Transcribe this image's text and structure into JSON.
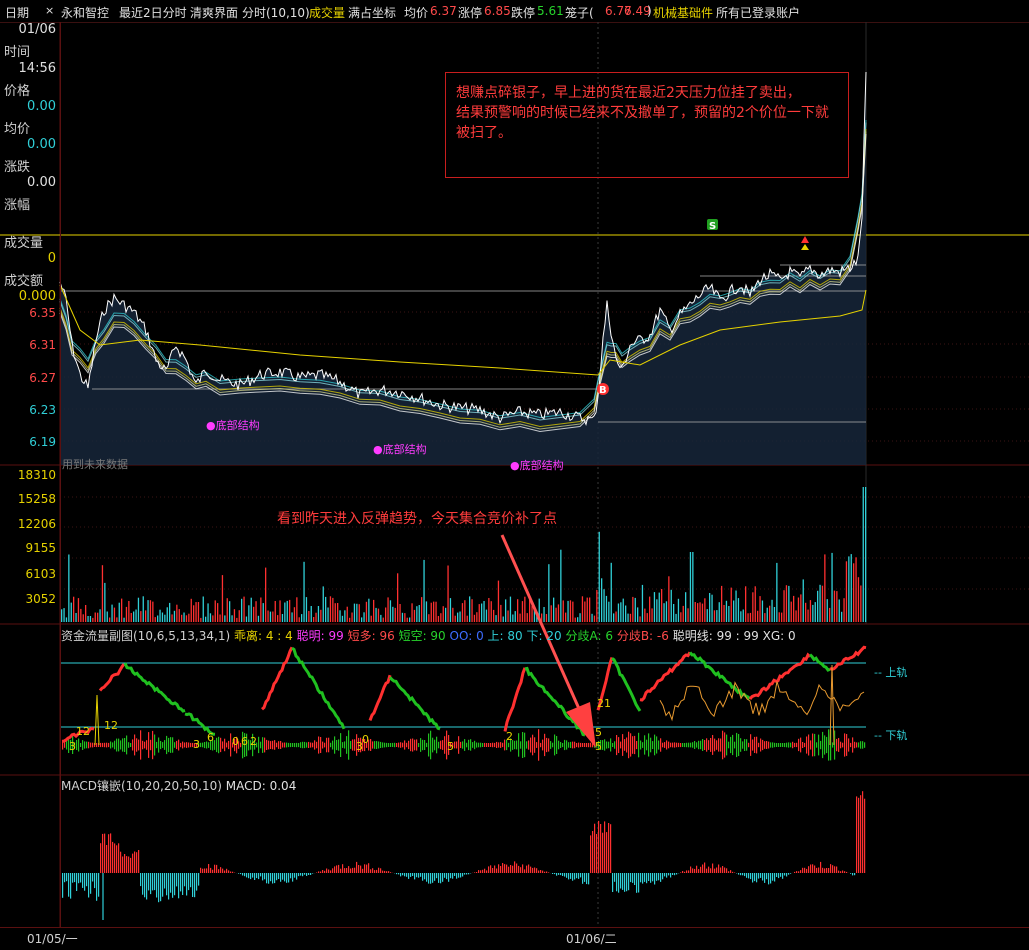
{
  "topbar": {
    "tab_label": "日期",
    "close_glyph": "×",
    "stock_name": "永和智控",
    "mode": "最近2日分时",
    "view": "清爽界面",
    "period": "分时(10,10)",
    "volume_label": "成交量",
    "coord": "满占坐标",
    "avg_label": "均价",
    "avg_value": "6.37",
    "limit_up_label": "涨停",
    "limit_up_value": "6.85",
    "limit_down_label": "跌停",
    "limit_down_value": "5.61",
    "cage_label": "笼子(",
    "cage_hi": "6.77",
    "cage_lo": "6.49",
    "cage_close": ")",
    "sector": "机械基础件",
    "accounts": "所有已登录账户"
  },
  "leftpanel": {
    "date_value": "01/06",
    "time_label": "时间",
    "time_value": "14:56",
    "price_label": "价格",
    "price_value": "0.00",
    "avg_label": "均价",
    "avg_value": "0.00",
    "change_label": "涨跌",
    "change_value": "0.00",
    "pct_label": "涨幅",
    "vol_label": "成交量",
    "vol_value": "0",
    "amount_label": "成交额",
    "amount_value": "0.000"
  },
  "price_axis": [
    "6.35",
    "6.31",
    "6.27",
    "6.23",
    "6.19"
  ],
  "volume_axis": [
    "18310",
    "15258",
    "12206",
    "9155",
    "6103",
    "3052"
  ],
  "future_label": "用到未来数据",
  "annotations": {
    "box_text": "想赚点碎银子，早上进的货在最近2天压力位挂了卖出，\n结果预警响的时候已经来不及撤单了，预留的2个价位一下就被扫了。",
    "arrow_text": "看到昨天进入反弹趋势，今天集合竞价补了点"
  },
  "bottom_marks": [
    "●底部结构",
    "●底部结构",
    "●底部结构"
  ],
  "signals": {
    "buy": "B",
    "sell": "S"
  },
  "flow_header": {
    "name": "资金流量副图(10,6,5,13,34,1)",
    "guai_label": "乖离: ",
    "guai_value": "4 : 4",
    "cong_label": "聪明: ",
    "cong_value": "99",
    "duan_label": "短多: ",
    "duan_value": "96",
    "short_label": "短空: ",
    "short_value": "90",
    "oo_label": "OO: ",
    "oo_value": "0",
    "up_label": "上: ",
    "up_value": "80",
    "down_label": "下: ",
    "down_value": "20",
    "diva_label": "分歧A: ",
    "diva_value": "6",
    "divb_label": "分歧B: ",
    "divb_value": "-6",
    "smart_label": "聪明线: ",
    "smart_value": "99 : 99",
    "xg_label": "XG: ",
    "xg_value": "0",
    "upper_rail": "-- 上轨",
    "lower_rail": "-- 下轨"
  },
  "flow_numbers": [
    "12",
    "12",
    "3",
    "3",
    "6",
    "0",
    "6",
    "2",
    "0",
    "3",
    "5",
    "2",
    "5",
    "21",
    "5"
  ],
  "macd_header": {
    "name": "MACD镶嵌(10,20,20,50,10)",
    "macd_label": "MACD: ",
    "macd_value": "0.04"
  },
  "xaxis": {
    "day1": "01/05/一",
    "day2": "01/06/二"
  },
  "colors": {
    "up": "#ff3030",
    "down": "#20c020",
    "yellow": "#e6d200",
    "cyan": "#30d0d8",
    "magenta": "#ff3cff",
    "frame": "#5a1010"
  }
}
